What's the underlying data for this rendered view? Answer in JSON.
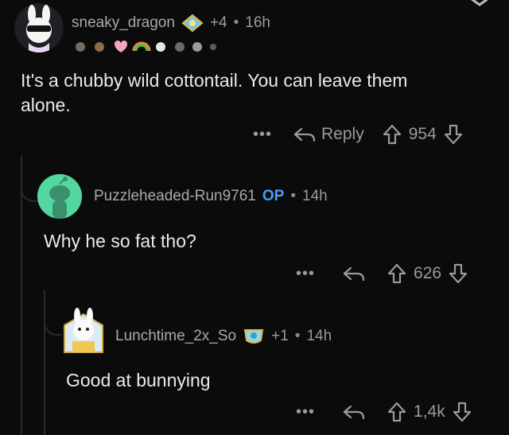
{
  "comments": [
    {
      "username": "sneaky_dragon",
      "extra": "+4",
      "time": "16h",
      "text_line1": "It's a chubby wild cottontail. You can leave them",
      "text_line2": "alone.",
      "reply_label": "Reply",
      "votes": "954"
    },
    {
      "username": "Puzzleheaded-Run9761",
      "op": "OP",
      "time": "14h",
      "text": "Why he so fat tho?",
      "votes": "626"
    },
    {
      "username": "Lunchtime_2x_So",
      "extra": "+1",
      "time": "14h",
      "text": "Good at bunnying",
      "votes": "1,4k"
    }
  ],
  "ui": {
    "separator": "•",
    "more": "•••"
  },
  "colors": {
    "op": "#4a9eff",
    "avatar_green": "#54d6a0",
    "background": "#0b0b0b"
  }
}
